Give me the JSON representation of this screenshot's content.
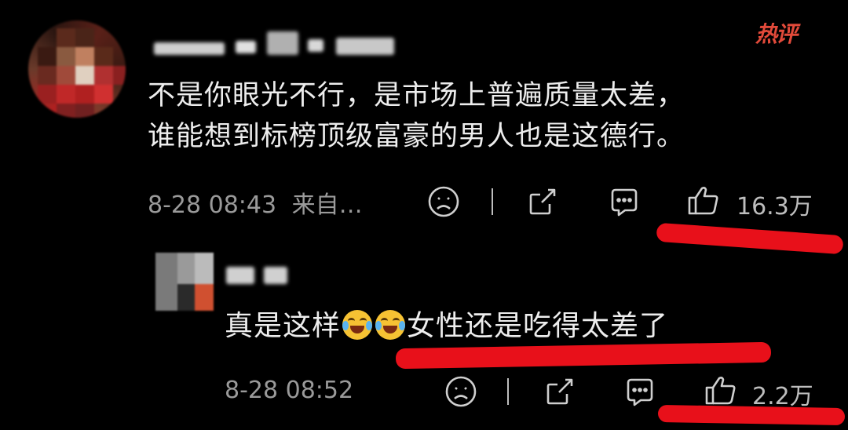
{
  "comment": {
    "text_line1": "不是你眼光不行，是市场上普遍质量太差，",
    "text_line2": "谁能想到标榜顶级富豪的男人也是这德行。",
    "timestamp": "8-28 08:43",
    "source": "来自…",
    "like_count": "16.3万",
    "badge": "热评"
  },
  "reply": {
    "text_before": "真是这样",
    "text_after": "女性还是吃得太差了",
    "timestamp": "8-28 08:52",
    "like_count": "2.2万"
  },
  "colors": {
    "background": "#000000",
    "text": "#ededed",
    "meta": "#9a9a9a",
    "highlight_red": "#e8101a",
    "badge_red": "#e24a3a"
  },
  "icons": [
    "sad-face-icon",
    "share-icon",
    "comment-icon",
    "thumbs-up-icon",
    "laughing-crying-emoji"
  ]
}
